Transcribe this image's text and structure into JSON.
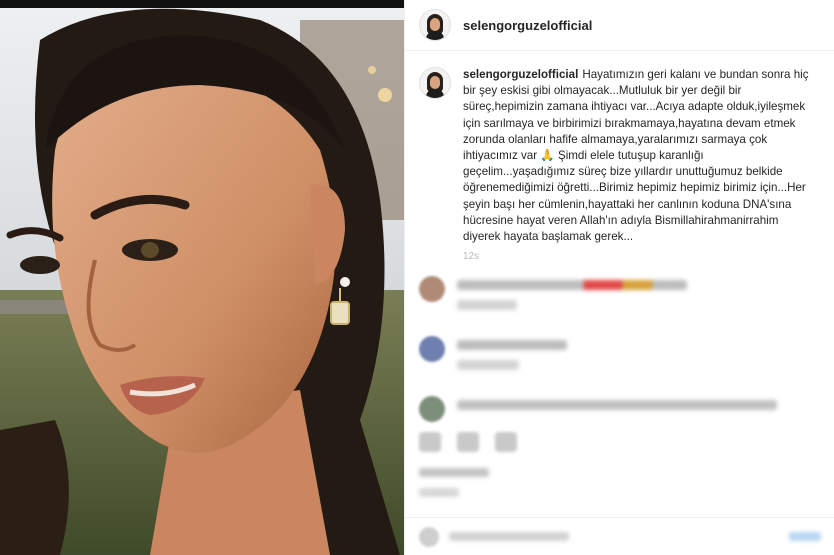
{
  "post": {
    "username": "selengorguzelofficial",
    "caption_username": "selengorguzelofficial",
    "caption_text": "Hayatımızın geri kalanı ve bundan sonra hiç bir şey eskisi gibi olmayacak...Mutluluk bir yer değil bir süreç,hepimizin zamana ihtiyacı var...Acıya adapte olduk,iyileşmek için sarılmaya ve birbirimizi bırakmamaya,hayatına devam etmek zorunda olanları hafife almamaya,yaralarımızı sarmaya çok ihtiyacımız var 🙏 Şimdi elele tutuşup karanlığı geçelim...yaşadığımız süreç bize yıllardır unuttuğumuz belkide öğrenemediğimizi öğretti...Birimiz hepimiz hepimiz birimiz için...Her şeyin başı her cümlenin,hayattaki her canlının koduna DNA'sına hücresine hayat veren Allah'ın adıyla Bismillahirahmanirrahim diyerek hayata başlamak gerek...",
    "caption_time": "12s"
  },
  "icons": {
    "avatar": "avatar-photo",
    "prayer": "folded-hands-emoji"
  },
  "colors": {
    "text": "#262626",
    "muted": "#b9b9b9",
    "border": "#efefef"
  }
}
